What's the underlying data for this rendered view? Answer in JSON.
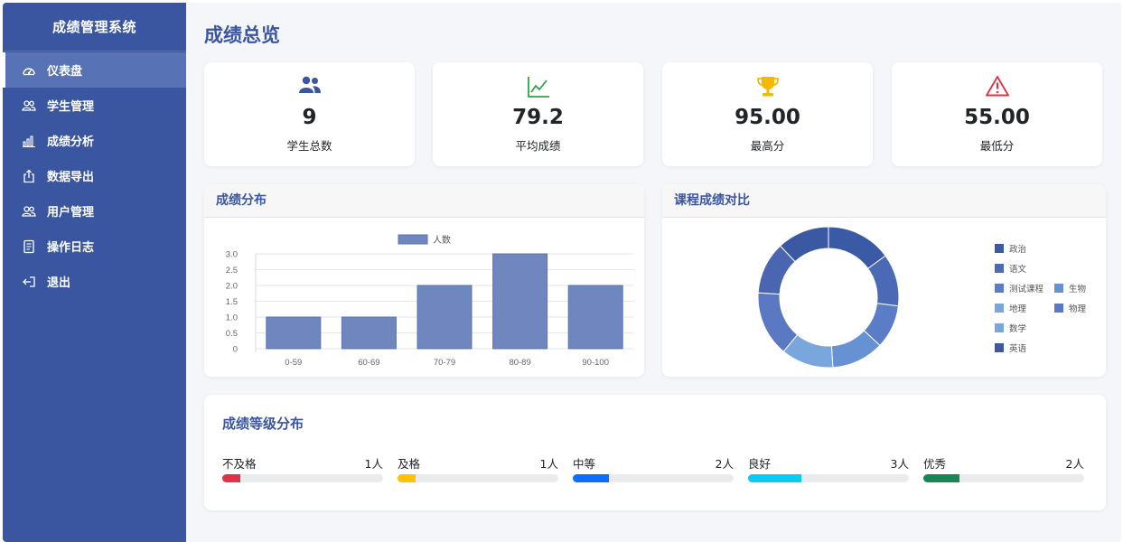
{
  "sidebar": {
    "title": "成绩管理系统",
    "items": [
      {
        "label": "仪表盘",
        "icon": "dashboard-icon",
        "active": true
      },
      {
        "label": "学生管理",
        "icon": "users-icon"
      },
      {
        "label": "成绩分析",
        "icon": "bar-chart-icon"
      },
      {
        "label": "数据导出",
        "icon": "export-icon"
      },
      {
        "label": "用户管理",
        "icon": "users-icon"
      },
      {
        "label": "操作日志",
        "icon": "log-icon"
      },
      {
        "label": "退出",
        "icon": "logout-icon"
      }
    ]
  },
  "page": {
    "title": "成绩总览"
  },
  "stats": [
    {
      "value": "9",
      "label": "学生总数",
      "icon": "people-icon",
      "color": "#3a56a0"
    },
    {
      "value": "79.2",
      "label": "平均成绩",
      "icon": "line-chart-icon",
      "color": "#28a745"
    },
    {
      "value": "95.00",
      "label": "最高分",
      "icon": "trophy-icon",
      "color": "#f5b800"
    },
    {
      "value": "55.00",
      "label": "最低分",
      "icon": "warning-icon",
      "color": "#dc3545"
    }
  ],
  "distribution": {
    "title": "成绩分布",
    "chart_data": {
      "type": "bar",
      "categories": [
        "0-59",
        "60-69",
        "70-79",
        "80-89",
        "90-100"
      ],
      "series": [
        {
          "name": "人数",
          "values": [
            1,
            1,
            2,
            3,
            2
          ]
        }
      ],
      "ylim": [
        0,
        3
      ],
      "yticks": [
        "0",
        "0.5",
        "1.0",
        "1.5",
        "2.0",
        "2.5",
        "3.0"
      ],
      "legend": "top",
      "grid": true,
      "color": "#6f86bf"
    }
  },
  "course": {
    "title": "课程成绩对比",
    "chart_data": {
      "type": "pie",
      "donut": true,
      "categories": [
        "政治",
        "语文",
        "测试课程",
        "生物",
        "地理",
        "物理",
        "数学",
        "英语"
      ],
      "values": [
        15,
        12,
        10,
        12,
        12,
        15,
        12,
        12
      ],
      "colors": [
        "#3a5aa6",
        "#4a6ab6",
        "#5b7cc6",
        "#6691d2",
        "#7aa6de",
        "#5a79c2",
        "#4a66b0",
        "#3b58a2"
      ],
      "legend": "right"
    }
  },
  "grades": {
    "title": "成绩等级分布",
    "items": [
      {
        "name": "不及格",
        "count": "1人",
        "fraction": 0.111,
        "color": "#dc3545"
      },
      {
        "name": "及格",
        "count": "1人",
        "fraction": 0.111,
        "color": "#ffc107"
      },
      {
        "name": "中等",
        "count": "2人",
        "fraction": 0.222,
        "color": "#0d6efd"
      },
      {
        "name": "良好",
        "count": "3人",
        "fraction": 0.333,
        "color": "#0dcaf0"
      },
      {
        "name": "优秀",
        "count": "2人",
        "fraction": 0.222,
        "color": "#198754"
      }
    ]
  }
}
